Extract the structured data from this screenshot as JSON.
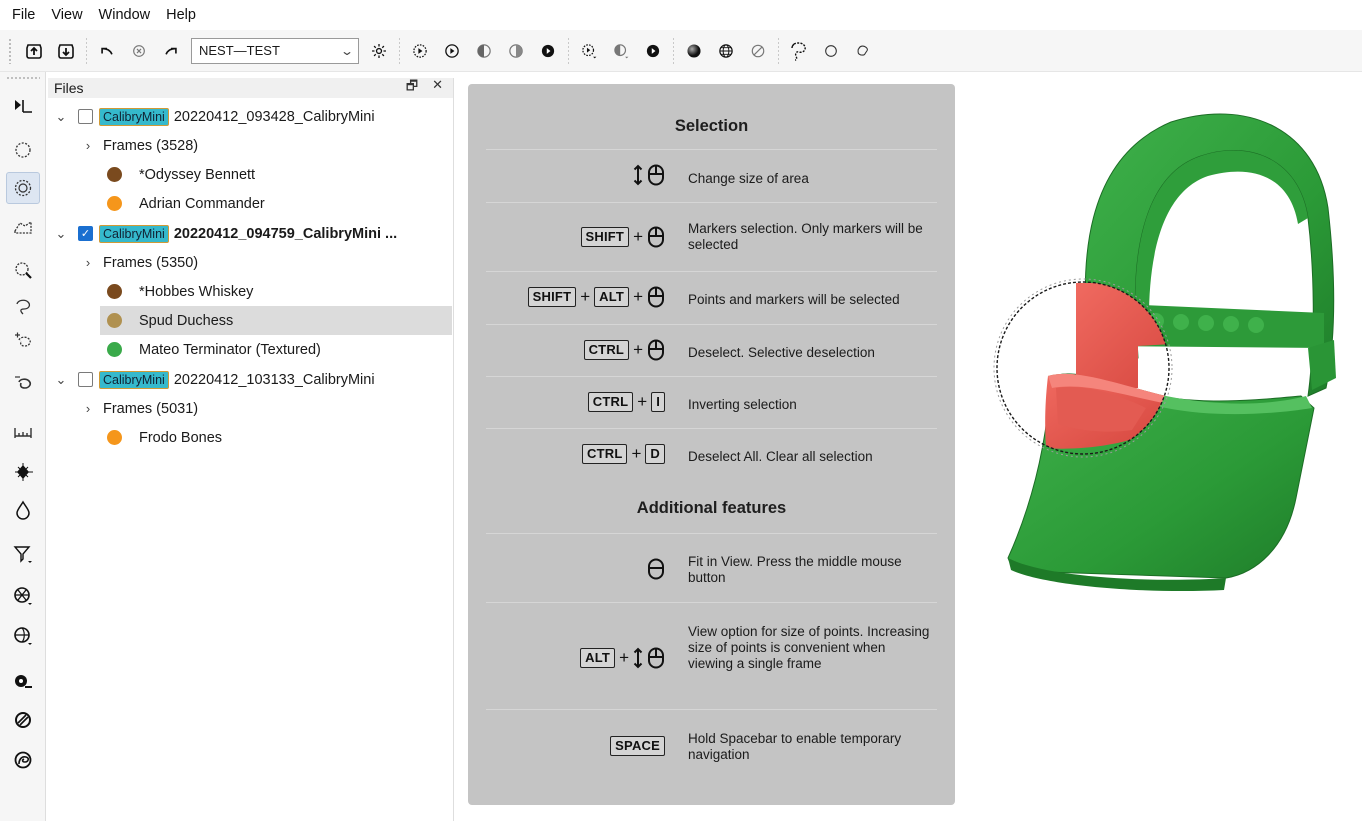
{
  "menu": [
    "File",
    "View",
    "Window",
    "Help"
  ],
  "toolbar": {
    "project_combo_value": "NEST—TEST"
  },
  "files_panel": {
    "title": "Files",
    "restore_glyph": "🗗",
    "close_glyph": "✕",
    "tree": [
      {
        "kind": "project",
        "expanded": true,
        "checked": false,
        "tag": "CalibryMini",
        "name": "20220412_093428_CalibryMini",
        "bold": false
      },
      {
        "kind": "frames",
        "label": "Frames (3528)"
      },
      {
        "kind": "object",
        "color": "#7a4a1e",
        "label": "*Odyssey Bennett"
      },
      {
        "kind": "object",
        "color": "#f5961b",
        "label": "Adrian Commander"
      },
      {
        "kind": "project",
        "expanded": true,
        "checked": true,
        "tag": "CalibryMini",
        "name": "20220412_094759_CalibryMini ...",
        "bold": true
      },
      {
        "kind": "frames",
        "label": "Frames (5350)"
      },
      {
        "kind": "object",
        "color": "#7a4a1e",
        "label": "*Hobbes Whiskey"
      },
      {
        "kind": "object",
        "color": "#b09150",
        "label": "Spud Duchess",
        "selected": true
      },
      {
        "kind": "object",
        "color": "#3aaa4a",
        "label": "Mateo Terminator (Textured)"
      },
      {
        "kind": "project",
        "expanded": true,
        "checked": false,
        "tag": "CalibryMini",
        "name": "20220412_103133_CalibryMini",
        "bold": false
      },
      {
        "kind": "frames",
        "label": "Frames (5031)"
      },
      {
        "kind": "object",
        "color": "#f5961b",
        "label": "Frodo Bones"
      }
    ]
  },
  "help": {
    "section1_title": "Selection",
    "section2_title": "Additional features",
    "plus": "+",
    "keys": {
      "shift": "SHIFT",
      "alt": "ALT",
      "ctrl": "CTRL",
      "i": "I",
      "d": "D",
      "space": "SPACE"
    },
    "rows": [
      {
        "id": "change-size",
        "desc": "Change size of area"
      },
      {
        "id": "shift",
        "desc": "Markers selection. Only markers will be selected"
      },
      {
        "id": "shift-alt",
        "desc": "Points and markers will be selected"
      },
      {
        "id": "ctrl",
        "desc": "Deselect. Selective deselection"
      },
      {
        "id": "ctrl-i",
        "desc": "Inverting selection"
      },
      {
        "id": "ctrl-d",
        "desc": "Deselect All. Clear all selection"
      },
      {
        "id": "fit",
        "desc": "Fit in View. Press the middle mouse button"
      },
      {
        "id": "alt-size",
        "desc": "View option for size of points. Increasing size of points is convenient when viewing a single frame"
      },
      {
        "id": "space",
        "desc": "Hold Spacebar to enable temporary navigation"
      }
    ]
  },
  "colors": {
    "model_green": "#2e9a3a",
    "selection_red": "#e0574f",
    "tag_cyan": "#35b9cc",
    "overlay_gray": "#c4c4c4"
  }
}
